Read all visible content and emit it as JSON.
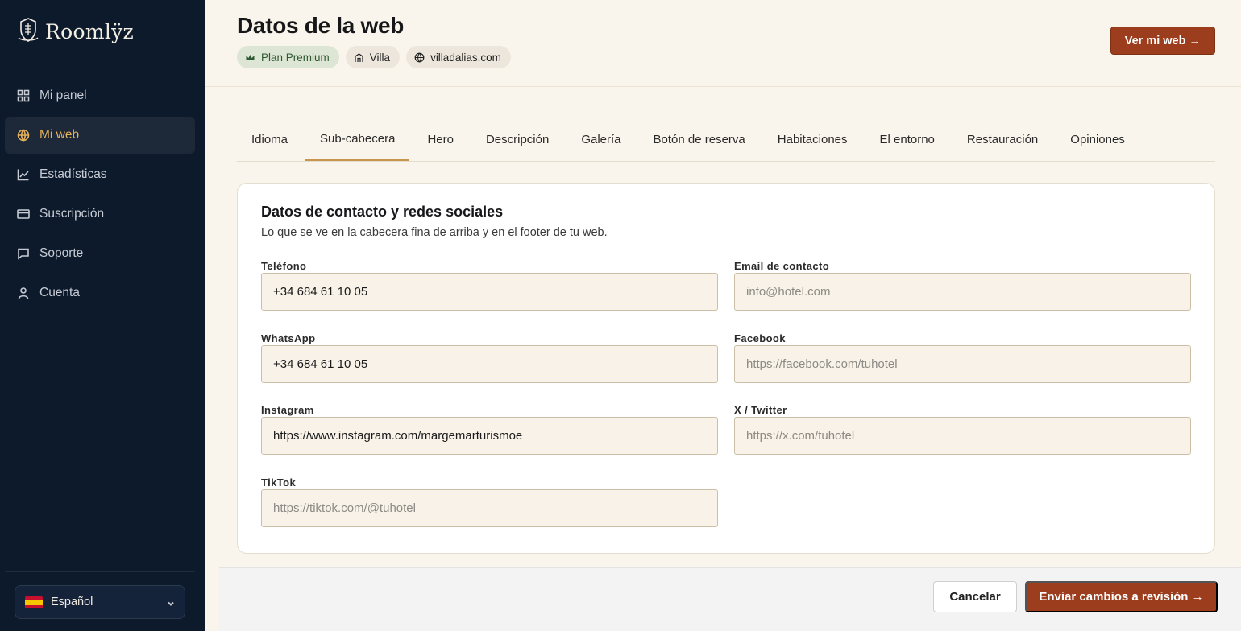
{
  "brand": {
    "name": "Roomlÿz"
  },
  "sidebar": {
    "items": [
      {
        "label": "Mi panel",
        "icon": "grid-icon",
        "active": false
      },
      {
        "label": "Mi web",
        "icon": "globe-icon",
        "active": true
      },
      {
        "label": "Estadísticas",
        "icon": "chart-line-icon",
        "active": false
      },
      {
        "label": "Suscripción",
        "icon": "card-icon",
        "active": false
      },
      {
        "label": "Soporte",
        "icon": "chat-icon",
        "active": false
      },
      {
        "label": "Cuenta",
        "icon": "user-icon",
        "active": false
      }
    ],
    "language": {
      "label": "Español",
      "flag": "spain-flag-icon"
    }
  },
  "header": {
    "title": "Datos de la web",
    "chips": [
      {
        "label": "Plan Premium",
        "icon": "crown-icon"
      },
      {
        "label": "Villa",
        "icon": "building-icon"
      },
      {
        "label": "villadalias.com",
        "icon": "globe-icon"
      }
    ],
    "view_button": "Ver mi web →"
  },
  "tabs": [
    {
      "label": "Idioma",
      "active": false
    },
    {
      "label": "Sub-cabecera",
      "active": true
    },
    {
      "label": "Hero",
      "active": false
    },
    {
      "label": "Descripción",
      "active": false
    },
    {
      "label": "Galería",
      "active": false
    },
    {
      "label": "Botón de reserva",
      "active": false
    },
    {
      "label": "Habitaciones",
      "active": false
    },
    {
      "label": "El entorno",
      "active": false
    },
    {
      "label": "Restauración",
      "active": false
    },
    {
      "label": "Opiniones",
      "active": false
    }
  ],
  "form": {
    "title": "Datos de contacto y redes sociales",
    "subtitle": "Lo que se ve en la cabecera fina de arriba y en el footer de tu web.",
    "fields": {
      "phone": {
        "label": "Teléfono",
        "value": "+34 684 61 10 05",
        "placeholder": ""
      },
      "email": {
        "label": "Email de contacto",
        "value": "",
        "placeholder": "info@hotel.com"
      },
      "whatsapp": {
        "label": "WhatsApp",
        "value": "+34 684 61 10 05",
        "placeholder": ""
      },
      "facebook": {
        "label": "Facebook",
        "value": "",
        "placeholder": "https://facebook.com/tuhotel"
      },
      "instagram": {
        "label": "Instagram",
        "value": "https://www.instagram.com/margemarturismoe",
        "placeholder": ""
      },
      "twitter": {
        "label": "X / Twitter",
        "value": "",
        "placeholder": "https://x.com/tuhotel"
      },
      "tiktok": {
        "label": "TikTok",
        "value": "",
        "placeholder": "https://tiktok.com/@tuhotel"
      }
    }
  },
  "footer": {
    "cancel": "Cancelar",
    "submit": "Enviar cambios a revisión →"
  },
  "colors": {
    "sidebar_bg": "#0d1a2c",
    "accent_gold": "#e6b25a",
    "primary_button": "#9c3e1d",
    "page_bg": "#faf5ec"
  }
}
